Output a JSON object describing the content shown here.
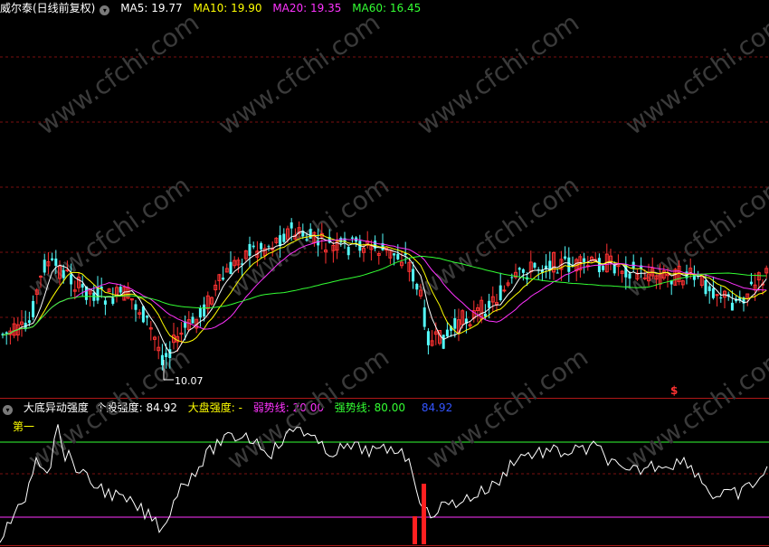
{
  "main_panel": {
    "stock_name": "威尔泰(日线前复权)",
    "ma": [
      {
        "label": "MA5: 19.77",
        "color": "#ffffff"
      },
      {
        "label": "MA10: 19.90",
        "color": "#ffff00"
      },
      {
        "label": "MA20: 19.35",
        "color": "#ff33ff"
      },
      {
        "label": "MA60: 16.45",
        "color": "#33ff33"
      }
    ],
    "low_annotation": "10.07",
    "signal_marker": "$"
  },
  "sub_panel": {
    "indicator_name": "大底异动强度",
    "items": [
      {
        "label": "个股强度: 84.92",
        "color": "#ffffff"
      },
      {
        "label": "大盘强度: -",
        "color": "#ffff00"
      },
      {
        "label": "弱势线: 20.00",
        "color": "#ff33ff"
      },
      {
        "label": "强势线: 80.00",
        "color": "#33ff33"
      },
      {
        "label": "84.92",
        "color": "#3333ff"
      }
    ],
    "first_label": "第一"
  },
  "watermark": "www.cfchi.com",
  "colors": {
    "up": "#ff3232",
    "down": "#54fcfc",
    "grid": "#7a1010",
    "border": "#b01818"
  }
}
